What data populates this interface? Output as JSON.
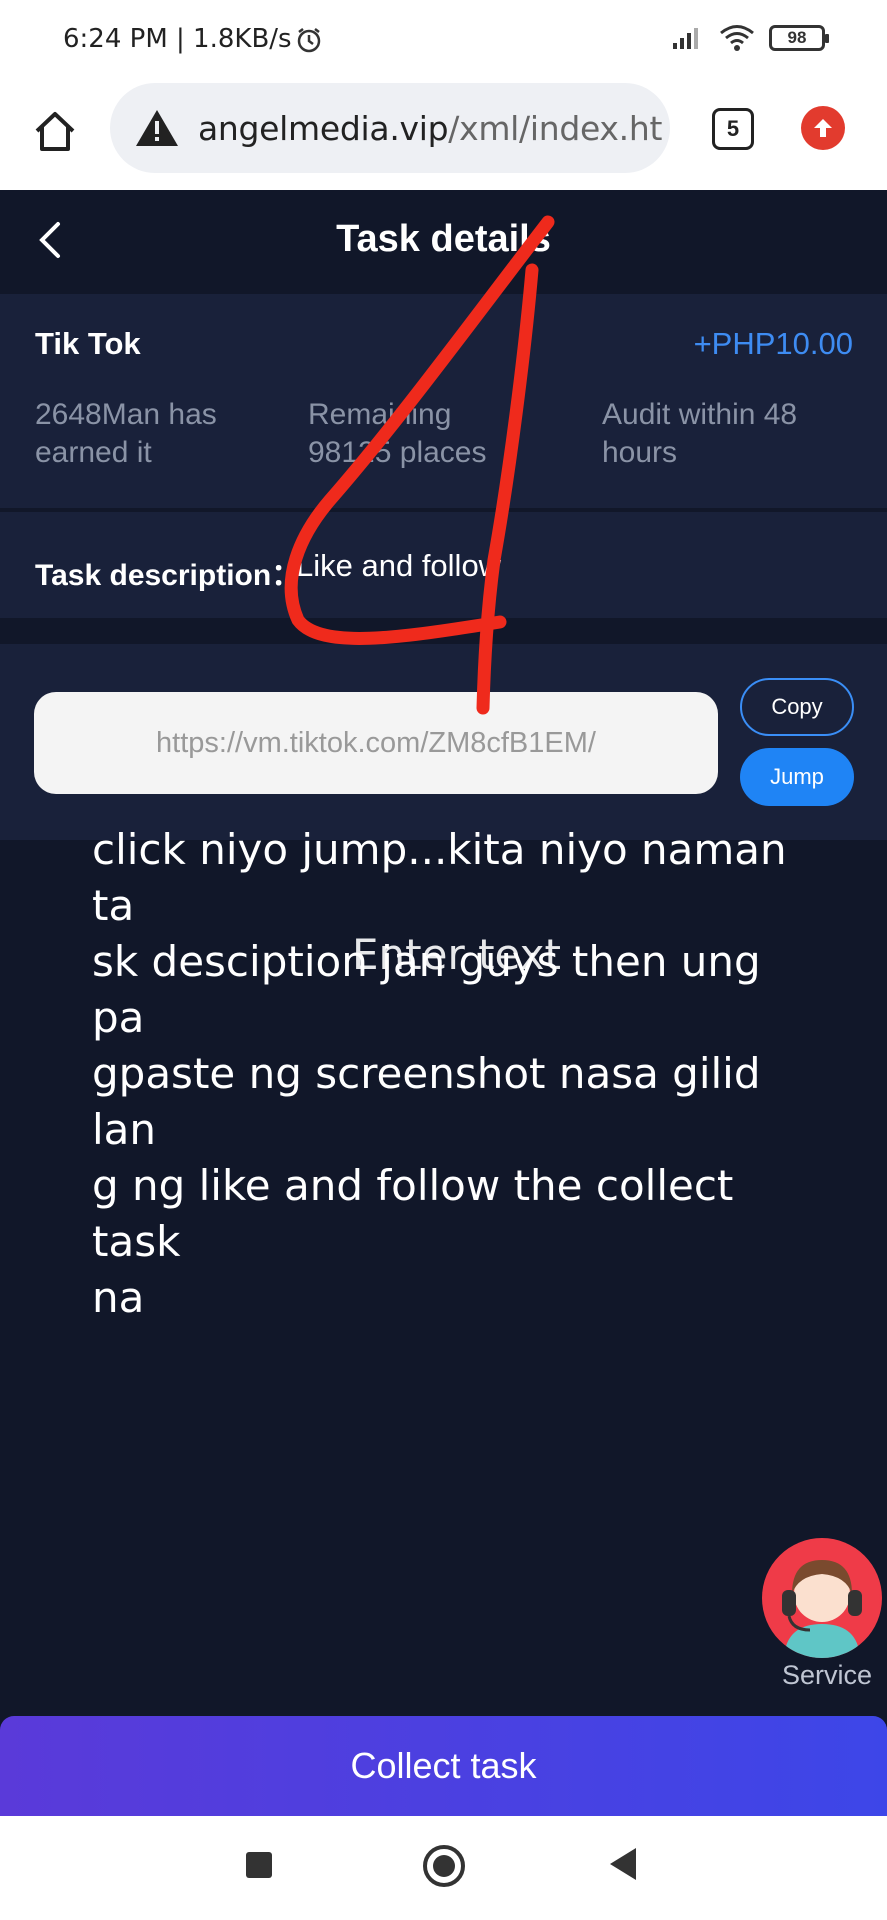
{
  "status_bar": {
    "time": "6:24 PM | 1.8KB/s",
    "battery": "98"
  },
  "browser": {
    "url_domain": "angelmedia.vip",
    "url_path": "/xml/index.ht",
    "tab_count": "5"
  },
  "header": {
    "title": "Task details"
  },
  "task": {
    "name": "Tik Tok",
    "reward": "+PHP10.00",
    "earned": "2648Man has earned it",
    "remaining": "Remaining 98125 places",
    "audit": "Audit within 48 hours",
    "description_label": "Task description：",
    "description_value": "Like and follow",
    "link": "https://vm.tiktok.com/ZM8cfB1EM/",
    "copy_label": "Copy",
    "jump_label": "Jump"
  },
  "overlay": {
    "note": "click niyo jump...kita niyo naman ta\nsk desciption jan guys then ung pa\ngpaste ng screenshot nasa gilid lan\ng ng like and follow the collect task\n na",
    "ghost": "Enter text",
    "scribble_number": "4",
    "scribble_color": "#ef2a1c"
  },
  "service": {
    "label": "Service"
  },
  "footer": {
    "collect_label": "Collect task"
  },
  "colors": {
    "background": "#111729",
    "card": "#19213a",
    "accent_blue": "#1f84f5",
    "reward_blue": "#3e8cf2",
    "collect_gradient_start": "#5a3ad9",
    "collect_gradient_end": "#3d46e8"
  }
}
